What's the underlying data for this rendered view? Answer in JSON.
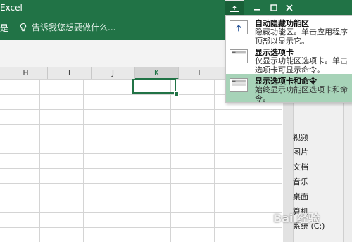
{
  "titlebar": {
    "app_title": "Excel",
    "left_fragment": "是",
    "tell_me": "告诉我您想要做什么...",
    "colors": {
      "bg": "#217346",
      "active_btn": "#196038"
    }
  },
  "window_controls": {
    "ribbon_options_icon": "ribbon-display-options-icon",
    "minimize_icon": "minimize-icon",
    "maximize_icon": "maximize-icon",
    "close_icon": "close-icon"
  },
  "columns": [
    {
      "label": "H",
      "selected": false
    },
    {
      "label": "I",
      "selected": false
    },
    {
      "label": "J",
      "selected": false
    },
    {
      "label": "K",
      "selected": true
    },
    {
      "label": "L",
      "selected": false
    }
  ],
  "dropdown": {
    "items": [
      {
        "title": "自动隐藏功能区",
        "desc": "隐藏功能区。单击应用程序顶部以显示它。",
        "icon": "auto-hide-ribbon-icon",
        "selected": false
      },
      {
        "title": "显示选项卡",
        "desc": "仅显示功能区选项卡。单击选项卡可显示命令。",
        "icon": "show-tabs-icon",
        "selected": false
      },
      {
        "title": "显示选项卡和命令",
        "desc": "始终显示功能区选项卡和命令。",
        "icon": "show-tabs-commands-icon",
        "selected": true
      }
    ],
    "selected_color": "#a7d3b8"
  },
  "right_panel": {
    "items": [
      "视频",
      "图片",
      "文档",
      "音乐",
      "桌面",
      "算机",
      "系统 (C:)"
    ]
  },
  "watermark": "Bai 经验"
}
